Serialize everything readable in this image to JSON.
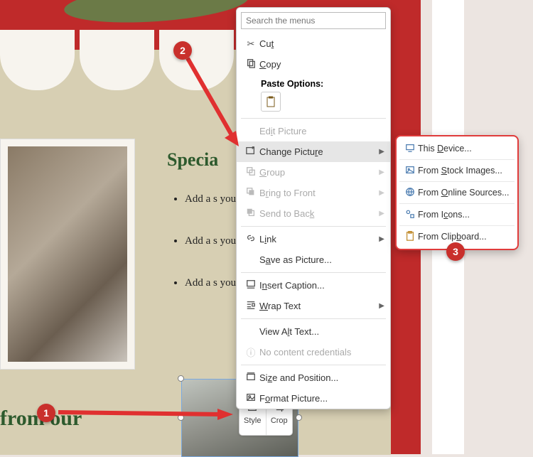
{
  "doc": {
    "heading": "Specia",
    "bullet_text": "Add a s your fa",
    "bottom_title": "from our"
  },
  "search_placeholder": "Search the menus",
  "mini_toolbar": {
    "style": "Style",
    "crop": "Crop"
  },
  "ctx": {
    "cut": {
      "html": "Cu<u>t</u>"
    },
    "copy": {
      "html": "<u>C</u>opy"
    },
    "paste_title": "Paste Options:",
    "edit_picture": {
      "html": "Ed<u>i</u>t Picture"
    },
    "change_picture": {
      "html": "Change Pictu<u>r</u>e"
    },
    "group": {
      "html": "<u>G</u>roup"
    },
    "bring_front": {
      "html": "B<u>r</u>ing to Front"
    },
    "send_back": {
      "html": "Send to Bac<u>k</u>"
    },
    "link": {
      "html": "L<u>i</u>nk"
    },
    "save_as_picture": {
      "html": "S<u>a</u>ve as Picture..."
    },
    "insert_caption": {
      "html": "I<u>n</u>sert Caption..."
    },
    "wrap_text": {
      "html": "<u>W</u>rap Text"
    },
    "view_alt": {
      "html": "View A<u>l</u>t Text..."
    },
    "no_credentials": {
      "html": "No content credentials"
    },
    "size_position": {
      "html": "Si<u>z</u>e and Position..."
    },
    "format_picture": {
      "html": "F<u>o</u>rmat Picture..."
    }
  },
  "submenu": {
    "this_device": {
      "html": "This <u>D</u>evice..."
    },
    "stock": {
      "html": "From <u>S</u>tock Images..."
    },
    "online": {
      "html": "From <u>O</u>nline Sources..."
    },
    "icons": {
      "html": "From I<u>c</u>ons..."
    },
    "clipboard": {
      "html": "From Clip<u>b</u>oard..."
    }
  },
  "callouts": {
    "c1": "1",
    "c2": "2",
    "c3": "3"
  }
}
